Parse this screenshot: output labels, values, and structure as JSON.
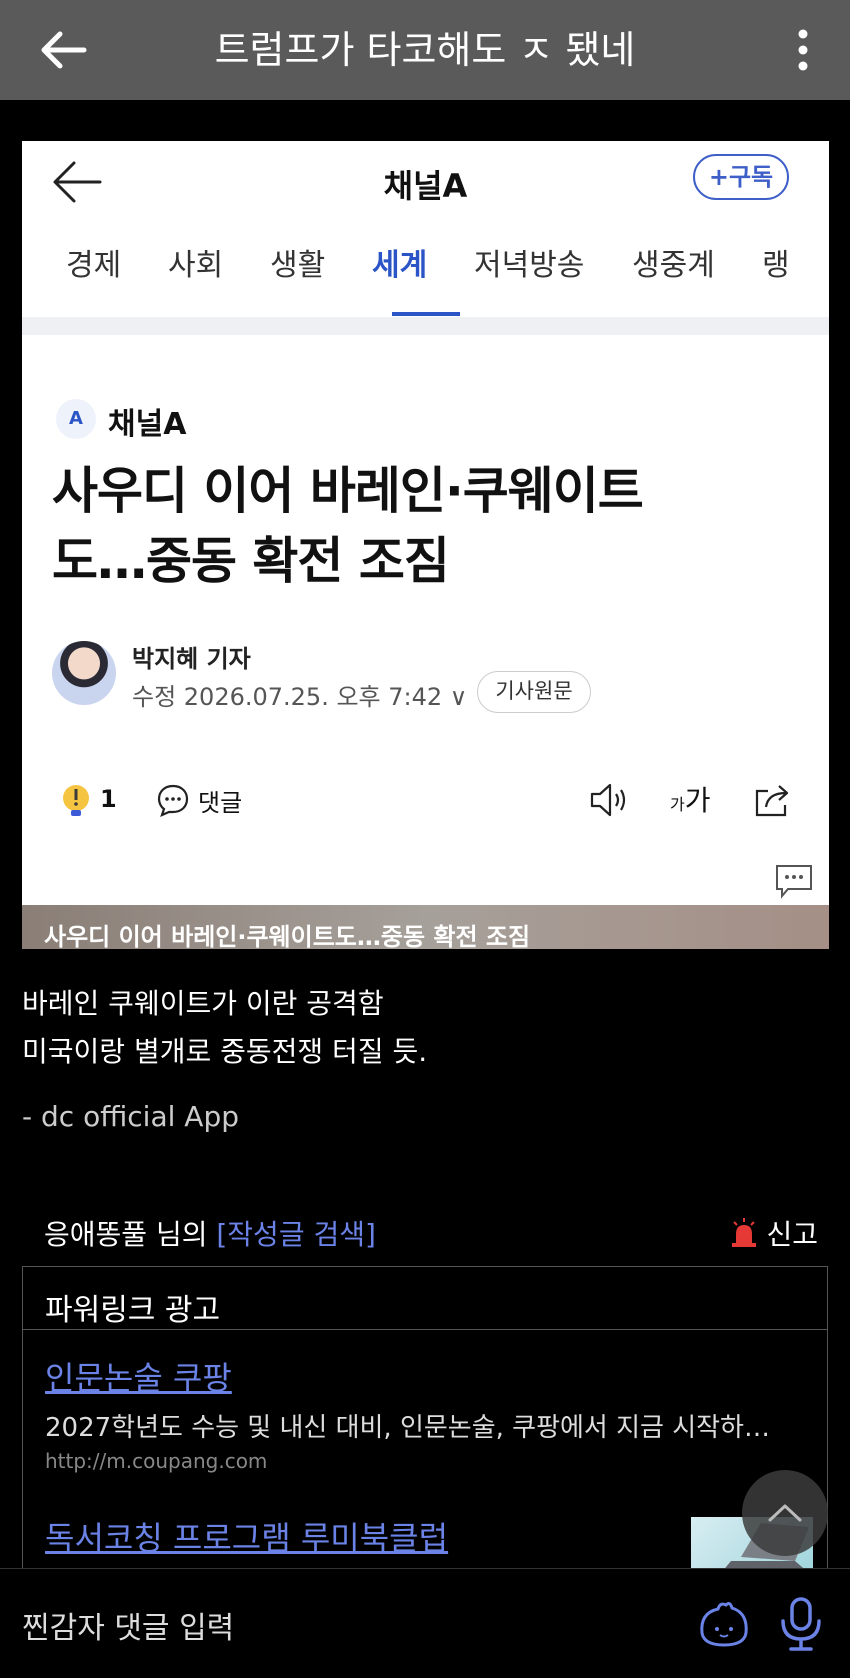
{
  "appbar": {
    "title": "트럼프가 타코해도 ㅈ 됐네"
  },
  "card": {
    "brand": "채널A",
    "subscribe": "+구독",
    "tabs": [
      "경제",
      "사회",
      "생활",
      "세계",
      "저녁방송",
      "생중계",
      "랭"
    ],
    "active_tab": "세계",
    "source_logo": "A",
    "source_name": "채널A",
    "headline_line1": "사우디 이어 바레인·쿠웨이트",
    "headline_line2": "도…중동 확전 조짐",
    "reporter": "박지혜 기자",
    "date": "수정 2026.07.25. 오후 7:42 ∨",
    "original_button": "기사원문",
    "bulb_count": "1",
    "comment_label": "댓글",
    "font_small": "가",
    "font_large": "가",
    "image_caption": "사우디 이어 바레인·쿠웨이트도…중동 확전 조짐"
  },
  "post": {
    "line1": "바레인 쿠웨이트가 이란 공격함",
    "line2": "미국이랑 별개로 중동전쟁 터질 듯.",
    "signature": "- dc official App"
  },
  "author_row": {
    "author": "응애똥풀 님의 ",
    "search_link": "[작성글 검색]",
    "report": "신고"
  },
  "ads": {
    "title": "파워링크 광고",
    "ad1_title": "인문논술 쿠팡",
    "ad1_desc": "2027학년도 수능 및 내신 대비, 인문논술, 쿠팡에서 지금 시작하…",
    "ad1_url": "http://m.coupang.com",
    "ad2_title": "독서코칭 프로그램 루미북클럽"
  },
  "bottombar": {
    "placeholder": "찐감자 댓글 입력"
  },
  "colors": {
    "appbar_bg": "#5a5a5a",
    "accent_blue": "#2b54c6",
    "link_blue": "#6b83e6"
  }
}
